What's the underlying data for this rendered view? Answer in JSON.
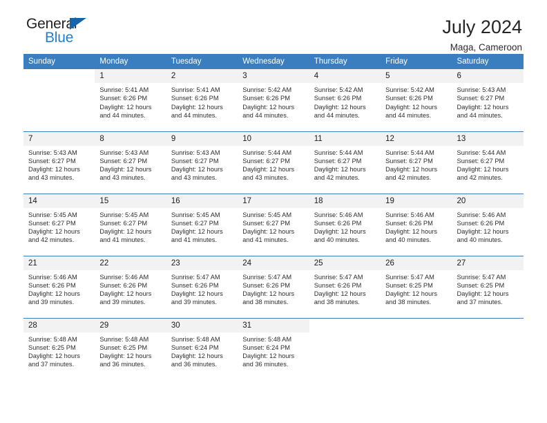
{
  "brand": {
    "name_part1": "General",
    "name_part2": "Blue",
    "triangle_color": "#1264ac",
    "blue_text_color": "#1f7fd0"
  },
  "header": {
    "title": "July 2024",
    "subtitle": "Maga, Cameroon",
    "header_bg_color": "#3a7ec0",
    "daynum_bg_color": "#f2f2f2"
  },
  "weekday_headers": [
    "Sunday",
    "Monday",
    "Tuesday",
    "Wednesday",
    "Thursday",
    "Friday",
    "Saturday"
  ],
  "labels": {
    "sunrise_prefix": "Sunrise:",
    "sunset_prefix": "Sunset:",
    "daylight_prefix": "Daylight:"
  },
  "weeks": [
    [
      {
        "day": "",
        "sunrise": "",
        "sunset": "",
        "daylight_line1": "",
        "daylight_line2": ""
      },
      {
        "day": "1",
        "sunrise": "Sunrise: 5:41 AM",
        "sunset": "Sunset: 6:26 PM",
        "daylight_line1": "Daylight: 12 hours",
        "daylight_line2": "and 44 minutes."
      },
      {
        "day": "2",
        "sunrise": "Sunrise: 5:41 AM",
        "sunset": "Sunset: 6:26 PM",
        "daylight_line1": "Daylight: 12 hours",
        "daylight_line2": "and 44 minutes."
      },
      {
        "day": "3",
        "sunrise": "Sunrise: 5:42 AM",
        "sunset": "Sunset: 6:26 PM",
        "daylight_line1": "Daylight: 12 hours",
        "daylight_line2": "and 44 minutes."
      },
      {
        "day": "4",
        "sunrise": "Sunrise: 5:42 AM",
        "sunset": "Sunset: 6:26 PM",
        "daylight_line1": "Daylight: 12 hours",
        "daylight_line2": "and 44 minutes."
      },
      {
        "day": "5",
        "sunrise": "Sunrise: 5:42 AM",
        "sunset": "Sunset: 6:26 PM",
        "daylight_line1": "Daylight: 12 hours",
        "daylight_line2": "and 44 minutes."
      },
      {
        "day": "6",
        "sunrise": "Sunrise: 5:43 AM",
        "sunset": "Sunset: 6:27 PM",
        "daylight_line1": "Daylight: 12 hours",
        "daylight_line2": "and 44 minutes."
      }
    ],
    [
      {
        "day": "7",
        "sunrise": "Sunrise: 5:43 AM",
        "sunset": "Sunset: 6:27 PM",
        "daylight_line1": "Daylight: 12 hours",
        "daylight_line2": "and 43 minutes."
      },
      {
        "day": "8",
        "sunrise": "Sunrise: 5:43 AM",
        "sunset": "Sunset: 6:27 PM",
        "daylight_line1": "Daylight: 12 hours",
        "daylight_line2": "and 43 minutes."
      },
      {
        "day": "9",
        "sunrise": "Sunrise: 5:43 AM",
        "sunset": "Sunset: 6:27 PM",
        "daylight_line1": "Daylight: 12 hours",
        "daylight_line2": "and 43 minutes."
      },
      {
        "day": "10",
        "sunrise": "Sunrise: 5:44 AM",
        "sunset": "Sunset: 6:27 PM",
        "daylight_line1": "Daylight: 12 hours",
        "daylight_line2": "and 43 minutes."
      },
      {
        "day": "11",
        "sunrise": "Sunrise: 5:44 AM",
        "sunset": "Sunset: 6:27 PM",
        "daylight_line1": "Daylight: 12 hours",
        "daylight_line2": "and 42 minutes."
      },
      {
        "day": "12",
        "sunrise": "Sunrise: 5:44 AM",
        "sunset": "Sunset: 6:27 PM",
        "daylight_line1": "Daylight: 12 hours",
        "daylight_line2": "and 42 minutes."
      },
      {
        "day": "13",
        "sunrise": "Sunrise: 5:44 AM",
        "sunset": "Sunset: 6:27 PM",
        "daylight_line1": "Daylight: 12 hours",
        "daylight_line2": "and 42 minutes."
      }
    ],
    [
      {
        "day": "14",
        "sunrise": "Sunrise: 5:45 AM",
        "sunset": "Sunset: 6:27 PM",
        "daylight_line1": "Daylight: 12 hours",
        "daylight_line2": "and 42 minutes."
      },
      {
        "day": "15",
        "sunrise": "Sunrise: 5:45 AM",
        "sunset": "Sunset: 6:27 PM",
        "daylight_line1": "Daylight: 12 hours",
        "daylight_line2": "and 41 minutes."
      },
      {
        "day": "16",
        "sunrise": "Sunrise: 5:45 AM",
        "sunset": "Sunset: 6:27 PM",
        "daylight_line1": "Daylight: 12 hours",
        "daylight_line2": "and 41 minutes."
      },
      {
        "day": "17",
        "sunrise": "Sunrise: 5:45 AM",
        "sunset": "Sunset: 6:27 PM",
        "daylight_line1": "Daylight: 12 hours",
        "daylight_line2": "and 41 minutes."
      },
      {
        "day": "18",
        "sunrise": "Sunrise: 5:46 AM",
        "sunset": "Sunset: 6:26 PM",
        "daylight_line1": "Daylight: 12 hours",
        "daylight_line2": "and 40 minutes."
      },
      {
        "day": "19",
        "sunrise": "Sunrise: 5:46 AM",
        "sunset": "Sunset: 6:26 PM",
        "daylight_line1": "Daylight: 12 hours",
        "daylight_line2": "and 40 minutes."
      },
      {
        "day": "20",
        "sunrise": "Sunrise: 5:46 AM",
        "sunset": "Sunset: 6:26 PM",
        "daylight_line1": "Daylight: 12 hours",
        "daylight_line2": "and 40 minutes."
      }
    ],
    [
      {
        "day": "21",
        "sunrise": "Sunrise: 5:46 AM",
        "sunset": "Sunset: 6:26 PM",
        "daylight_line1": "Daylight: 12 hours",
        "daylight_line2": "and 39 minutes."
      },
      {
        "day": "22",
        "sunrise": "Sunrise: 5:46 AM",
        "sunset": "Sunset: 6:26 PM",
        "daylight_line1": "Daylight: 12 hours",
        "daylight_line2": "and 39 minutes."
      },
      {
        "day": "23",
        "sunrise": "Sunrise: 5:47 AM",
        "sunset": "Sunset: 6:26 PM",
        "daylight_line1": "Daylight: 12 hours",
        "daylight_line2": "and 39 minutes."
      },
      {
        "day": "24",
        "sunrise": "Sunrise: 5:47 AM",
        "sunset": "Sunset: 6:26 PM",
        "daylight_line1": "Daylight: 12 hours",
        "daylight_line2": "and 38 minutes."
      },
      {
        "day": "25",
        "sunrise": "Sunrise: 5:47 AM",
        "sunset": "Sunset: 6:26 PM",
        "daylight_line1": "Daylight: 12 hours",
        "daylight_line2": "and 38 minutes."
      },
      {
        "day": "26",
        "sunrise": "Sunrise: 5:47 AM",
        "sunset": "Sunset: 6:25 PM",
        "daylight_line1": "Daylight: 12 hours",
        "daylight_line2": "and 38 minutes."
      },
      {
        "day": "27",
        "sunrise": "Sunrise: 5:47 AM",
        "sunset": "Sunset: 6:25 PM",
        "daylight_line1": "Daylight: 12 hours",
        "daylight_line2": "and 37 minutes."
      }
    ],
    [
      {
        "day": "28",
        "sunrise": "Sunrise: 5:48 AM",
        "sunset": "Sunset: 6:25 PM",
        "daylight_line1": "Daylight: 12 hours",
        "daylight_line2": "and 37 minutes."
      },
      {
        "day": "29",
        "sunrise": "Sunrise: 5:48 AM",
        "sunset": "Sunset: 6:25 PM",
        "daylight_line1": "Daylight: 12 hours",
        "daylight_line2": "and 36 minutes."
      },
      {
        "day": "30",
        "sunrise": "Sunrise: 5:48 AM",
        "sunset": "Sunset: 6:24 PM",
        "daylight_line1": "Daylight: 12 hours",
        "daylight_line2": "and 36 minutes."
      },
      {
        "day": "31",
        "sunrise": "Sunrise: 5:48 AM",
        "sunset": "Sunset: 6:24 PM",
        "daylight_line1": "Daylight: 12 hours",
        "daylight_line2": "and 36 minutes."
      },
      {
        "day": "",
        "sunrise": "",
        "sunset": "",
        "daylight_line1": "",
        "daylight_line2": ""
      },
      {
        "day": "",
        "sunrise": "",
        "sunset": "",
        "daylight_line1": "",
        "daylight_line2": ""
      },
      {
        "day": "",
        "sunrise": "",
        "sunset": "",
        "daylight_line1": "",
        "daylight_line2": ""
      }
    ]
  ]
}
